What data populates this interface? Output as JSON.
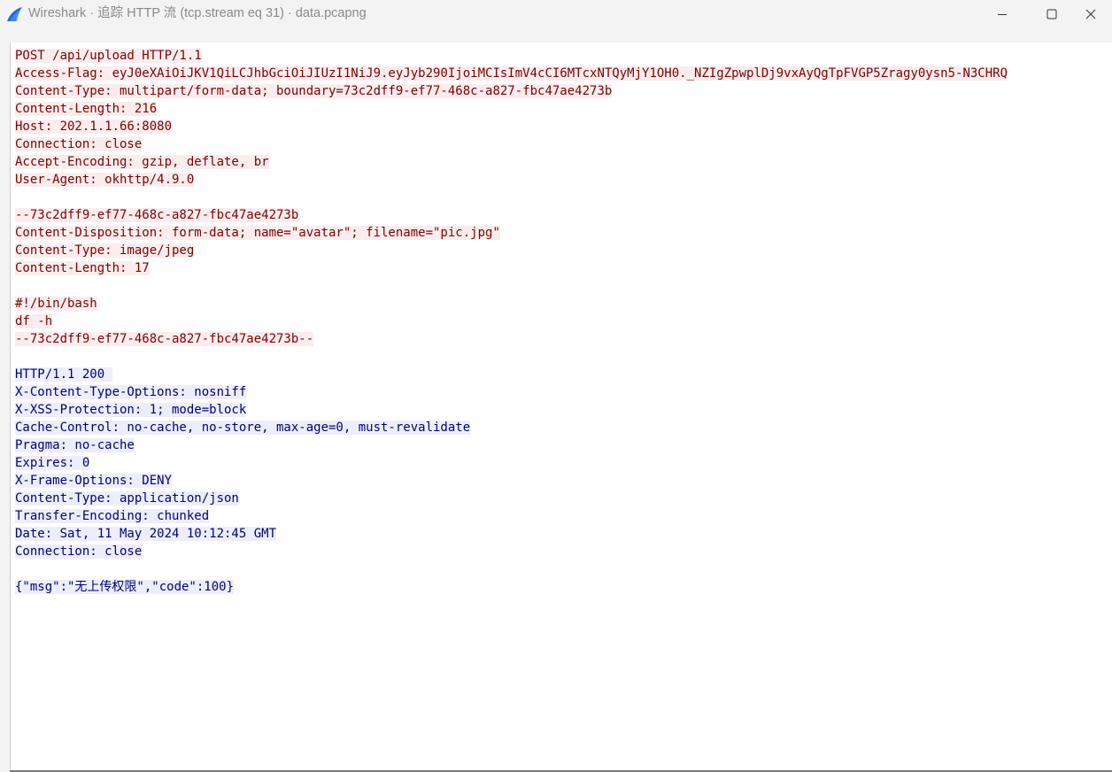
{
  "window": {
    "title": "Wireshark · 追踪 HTTP 流 (tcp.stream eq 31) · data.pcapng"
  },
  "icons": {
    "app": "wireshark-fin-icon",
    "minimize": "minimize-icon",
    "maximize": "maximize-icon",
    "close": "close-icon"
  },
  "colors": {
    "client_bg": "#fbeded",
    "client_fg": "#7f0000",
    "server_bg": "#edeefb",
    "server_fg": "#00007f"
  },
  "stream": {
    "request": [
      "POST /api/upload HTTP/1.1",
      "Access-Flag: eyJ0eXAiOiJKV1QiLCJhbGciOiJIUzI1NiJ9.eyJyb290IjoiMCIsImV4cCI6MTcxNTQyMjY1OH0._NZIgZpwplDj9vxAyQgTpFVGP5Zragy0ysn5-N3CHRQ",
      "Content-Type: multipart/form-data; boundary=73c2dff9-ef77-468c-a827-fbc47ae4273b",
      "Content-Length: 216",
      "Host: 202.1.1.66:8080",
      "Connection: close",
      "Accept-Encoding: gzip, deflate, br",
      "User-Agent: okhttp/4.9.0",
      "",
      "--73c2dff9-ef77-468c-a827-fbc47ae4273b",
      "Content-Disposition: form-data; name=\"avatar\"; filename=\"pic.jpg\"",
      "Content-Type: image/jpeg",
      "Content-Length: 17",
      "",
      "#!/bin/bash",
      "df -h",
      "--73c2dff9-ef77-468c-a827-fbc47ae4273b--",
      ""
    ],
    "response": [
      "HTTP/1.1 200 ",
      "X-Content-Type-Options: nosniff",
      "X-XSS-Protection: 1; mode=block",
      "Cache-Control: no-cache, no-store, max-age=0, must-revalidate",
      "Pragma: no-cache",
      "Expires: 0",
      "X-Frame-Options: DENY",
      "Content-Type: application/json",
      "Transfer-Encoding: chunked",
      "Date: Sat, 11 May 2024 10:12:45 GMT",
      "Connection: close",
      "",
      "{\"msg\":\"无上传权限\",\"code\":100}"
    ]
  }
}
